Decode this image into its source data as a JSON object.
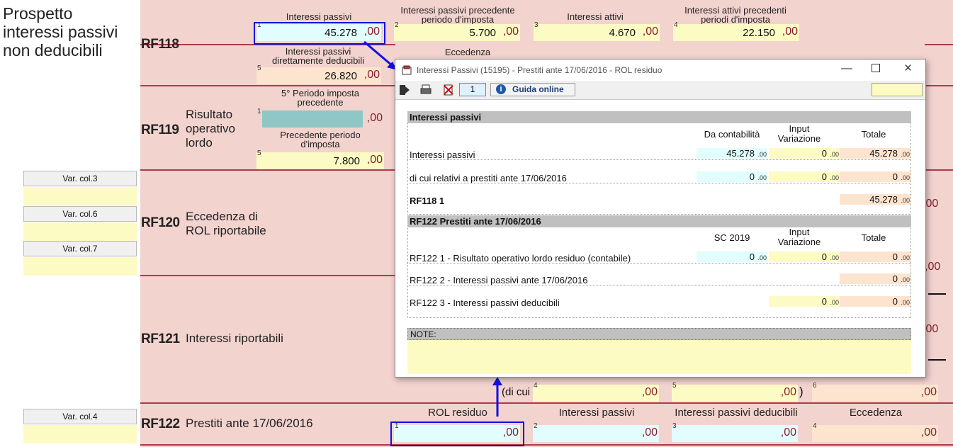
{
  "left_title": "Prospetto interessi passivi non deducibili",
  "rows": {
    "rf118": {
      "code": "RF118"
    },
    "rf119": {
      "code": "RF119",
      "desc": "Risultato operativo lordo"
    },
    "rf120": {
      "code": "RF120",
      "desc": "Eccedenza di ROL riportabile"
    },
    "rf121": {
      "code": "RF121",
      "desc": "Interessi riportabili"
    },
    "rf122": {
      "code": "RF122",
      "desc": "Prestiti ante 17/06/2016"
    }
  },
  "rf118_fields": [
    {
      "num": "1",
      "label": "Interessi passivi",
      "value": "45.278",
      "dec": ",00"
    },
    {
      "num": "2",
      "label": "Interessi passivi precedente periodo d'imposta",
      "value": "5.700",
      "dec": ",00"
    },
    {
      "num": "3",
      "label": "Interessi attivi",
      "value": "4.670",
      "dec": ",00"
    },
    {
      "num": "4",
      "label": "Interessi attivi precedenti periodi d'imposta",
      "value": "22.150",
      "dec": ",00"
    },
    {
      "num": "5",
      "label": "Interessi passivi direttamente deducibili",
      "value": "26.820",
      "dec": ",00"
    },
    {
      "label": "Eccedenza"
    }
  ],
  "rf119_fields": [
    {
      "num": "1",
      "label": "5° Periodo imposta precedente",
      "value": "",
      "dec": ",00"
    },
    {
      "num": "5",
      "label": "Precedente periodo d'imposta",
      "value": "7.800",
      "dec": ",00"
    }
  ],
  "var_buttons": [
    "Var. col.3",
    "Var. col.6",
    "Var. col.7",
    "Var. col.4"
  ],
  "rf121_dicui": "(di cui",
  "rf121_fields": [
    {
      "num": "4",
      "dec": ",00"
    },
    {
      "num": "5",
      "dec": ",00"
    },
    {
      "num": "6",
      "dec": ",00"
    }
  ],
  "rf122_fields": [
    {
      "num": "1",
      "label": "ROL residuo",
      "dec": ",00"
    },
    {
      "num": "2",
      "label": "Interessi passivi",
      "dec": ",00"
    },
    {
      "num": "3",
      "label": "Interessi passivi deducibili",
      "dec": ",00"
    },
    {
      "num": "4",
      "label": "Eccedenza",
      "dec": ",00"
    }
  ],
  "right_partial_dec": ",00",
  "dialog": {
    "title": "Interessi Passivi (15195) - Prestiti ante 17/06/2016 - ROL residuo",
    "page_num": "1",
    "guida": "Guida online",
    "section1": {
      "header": "Interessi passivi",
      "col_da": "Da contabilità",
      "col_input": "Input Variazione",
      "col_tot": "Totale",
      "rows": [
        {
          "label": "Interessi passivi",
          "da": "45.278",
          "input": "0",
          "tot": "45.278"
        },
        {
          "label": "di cui relativi a prestiti ante 17/06/2016",
          "da": "0",
          "input": "0",
          "tot": "0"
        },
        {
          "label": "RF118  1",
          "tot": "45.278"
        }
      ]
    },
    "section2": {
      "header": "RF122 Prestiti ante 17/06/2016",
      "col_sc": "SC 2019",
      "col_input": "Input Variazione",
      "col_tot": "Totale",
      "rows": [
        {
          "label": "RF122  1 - Risultato operativo lordo residuo  (contabile)",
          "sc": "0",
          "input": "0",
          "tot": "0"
        },
        {
          "label": "RF122  2 - Interessi passivi ante 17/06/2016",
          "tot": "0"
        },
        {
          "label": "RF122  3 -  Interessi passivi deducibili",
          "input": "0",
          "tot": "0"
        }
      ]
    },
    "dec": ".00",
    "notes_label": "NOTE:"
  },
  "colors": {
    "form_bg": "#f2d3ce",
    "red_line": "#b03a4a",
    "highlight": "#1010e6"
  }
}
